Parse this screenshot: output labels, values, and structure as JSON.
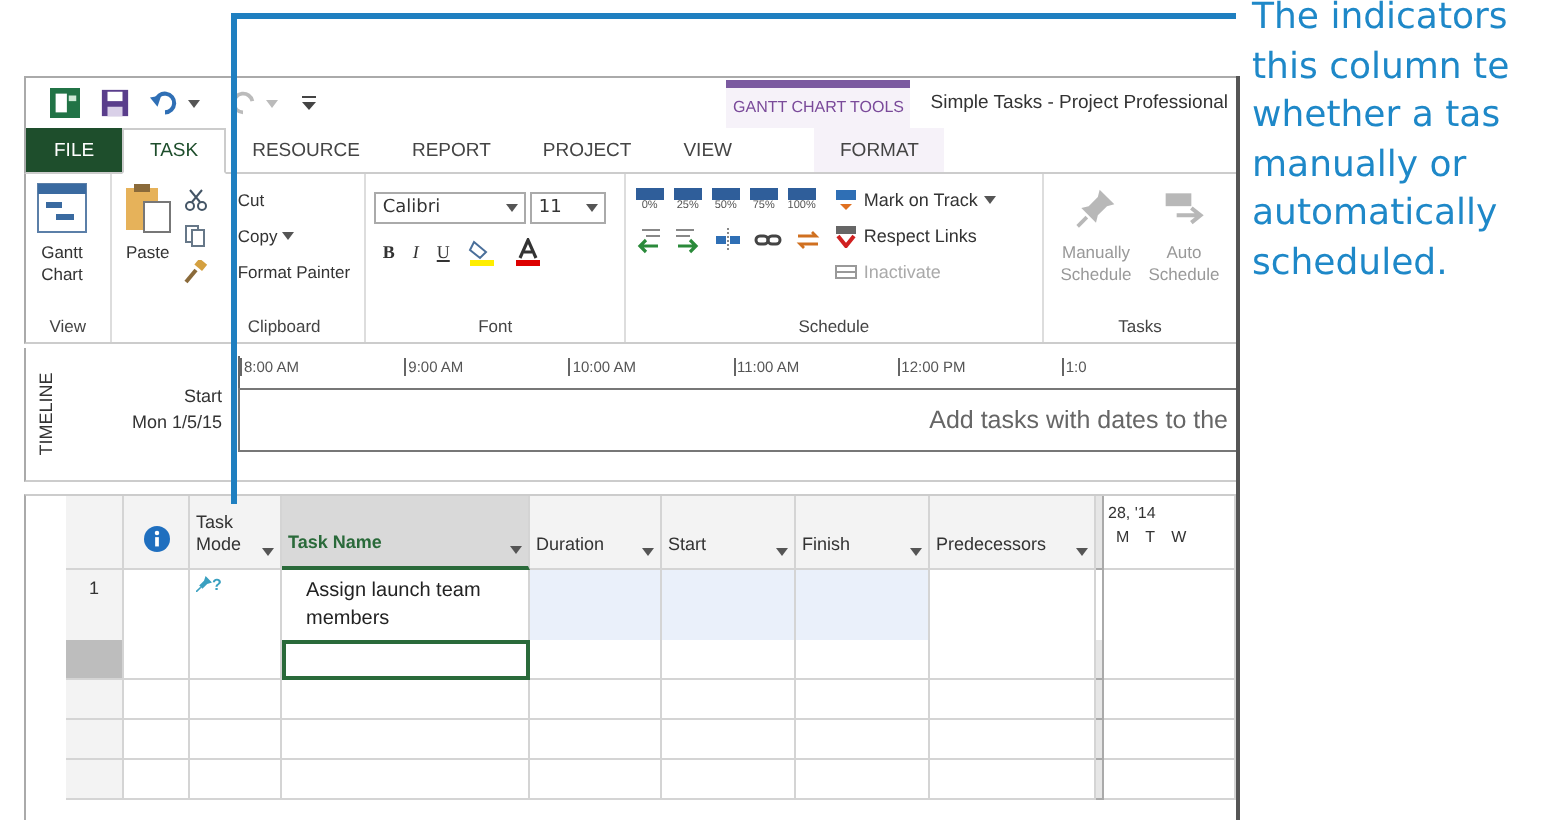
{
  "callout": {
    "lines": [
      "The indicators",
      "this column te",
      "whether a tas",
      "manually or",
      "automatically",
      "scheduled."
    ]
  },
  "title_bar": {
    "context_group": "GANTT CHART TOOLS",
    "title": "Simple Tasks - Project Professional"
  },
  "tabs": [
    {
      "label": "FILE",
      "kind": "file",
      "selected": false
    },
    {
      "label": "TASK",
      "kind": "normal",
      "selected": true
    },
    {
      "label": "RESOURCE",
      "kind": "normal",
      "selected": false
    },
    {
      "label": "REPORT",
      "kind": "normal",
      "selected": false
    },
    {
      "label": "PROJECT",
      "kind": "normal",
      "selected": false
    },
    {
      "label": "VIEW",
      "kind": "normal",
      "selected": false
    },
    {
      "label": "FORMAT",
      "kind": "contextual",
      "selected": false
    }
  ],
  "ribbon": {
    "view": {
      "label": "View",
      "button": [
        "Gantt",
        "Chart"
      ]
    },
    "clipboard": {
      "label": "Clipboard",
      "paste": "Paste",
      "commands": [
        {
          "label": "Cut",
          "kind": "cut",
          "dropdown": false
        },
        {
          "label": "Copy",
          "kind": "copy",
          "dropdown": true
        },
        {
          "label": "Format Painter",
          "kind": "painter",
          "dropdown": false
        }
      ]
    },
    "font": {
      "label": "Font",
      "family": "Calibri",
      "size": "11",
      "styles": [
        {
          "label": "B",
          "kind": "bold"
        },
        {
          "label": "I",
          "kind": "italic"
        },
        {
          "label": "U",
          "kind": "underline"
        }
      ]
    },
    "schedule": {
      "label": "Schedule",
      "percents": [
        "0%",
        "25%",
        "50%",
        "75%",
        "100%"
      ],
      "commands": [
        {
          "label": "Mark on Track",
          "kind": "track",
          "dropdown": true,
          "disabled": false
        },
        {
          "label": "Respect Links",
          "kind": "links",
          "dropdown": false,
          "disabled": false
        },
        {
          "label": "Inactivate",
          "kind": "inactivate",
          "dropdown": false,
          "disabled": true
        }
      ]
    },
    "tasks": {
      "label": "Tasks",
      "buttons": [
        {
          "label": [
            "Manually",
            "Schedule"
          ],
          "kind": "manual",
          "disabled": true
        },
        {
          "label": [
            "Auto",
            "Schedule"
          ],
          "kind": "auto",
          "disabled": true
        }
      ]
    }
  },
  "timeline": {
    "label": "TIMELINE",
    "start_label": "Start",
    "start_date": "Mon 1/5/15",
    "ticks": [
      "8:00 AM",
      "9:00 AM",
      "10:00 AM",
      "11:00 AM",
      "12:00 PM",
      "1:0"
    ],
    "message": "Add tasks with dates to the"
  },
  "grid": {
    "columns": [
      {
        "kind": "info",
        "dropdown": false,
        "selected": false
      },
      {
        "label": "Task Mode",
        "kind": "text",
        "dropdown": true,
        "selected": false
      },
      {
        "label": "Task Name",
        "kind": "text",
        "dropdown": true,
        "selected": true
      },
      {
        "label": "Duration",
        "kind": "text",
        "dropdown": true,
        "selected": false
      },
      {
        "label": "Start",
        "kind": "text",
        "dropdown": true,
        "selected": false
      },
      {
        "label": "Finish",
        "kind": "text",
        "dropdown": true,
        "selected": false
      },
      {
        "label": "Predecessors",
        "kind": "text",
        "dropdown": true,
        "selected": false
      }
    ],
    "gantt_header": {
      "date": "28, '14",
      "days": [
        "M",
        "T",
        "W"
      ]
    },
    "rows": [
      {
        "kind": "task",
        "number": "1",
        "mode_mark": "?",
        "name": "Assign launch team members",
        "selected": false
      },
      {
        "kind": "blank",
        "selected": true
      },
      {
        "kind": "blank",
        "selected": false
      },
      {
        "kind": "blank",
        "selected": false
      },
      {
        "kind": "blank",
        "selected": false
      }
    ]
  }
}
